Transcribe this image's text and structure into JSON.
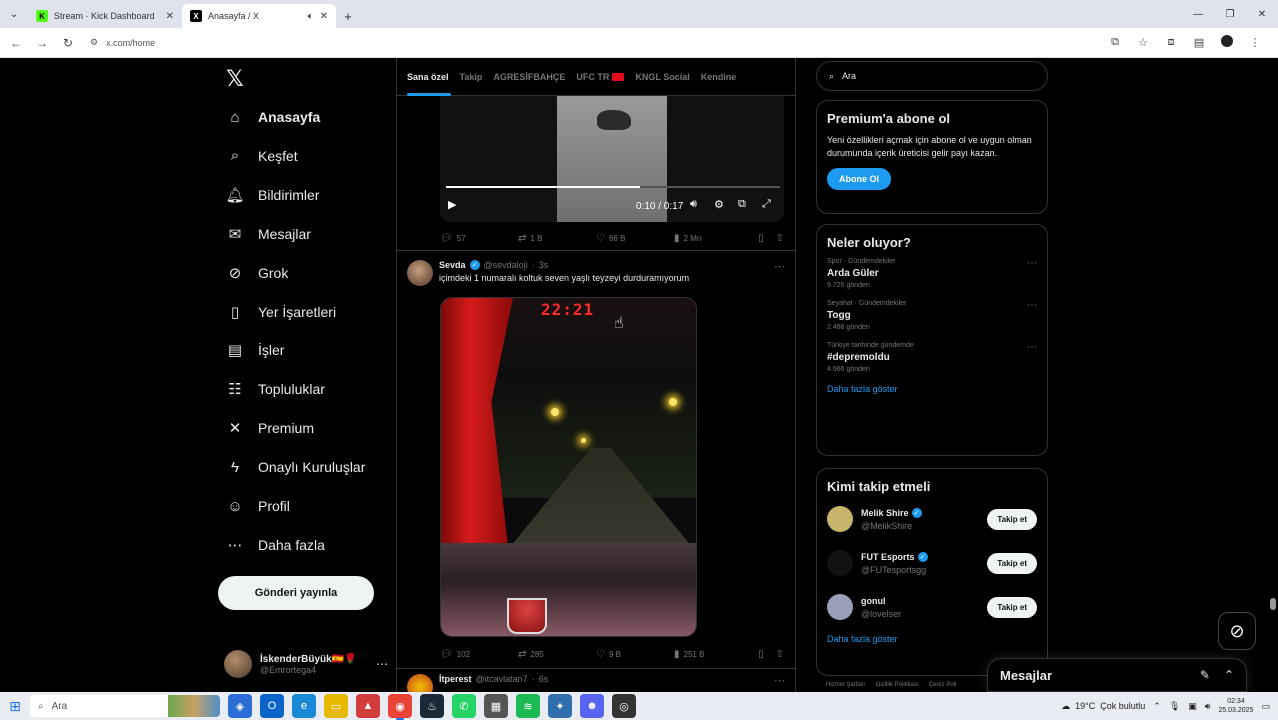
{
  "browser": {
    "tabs": [
      {
        "title": "Stream · Kick Dashboard",
        "favicon": "K",
        "favicon_color": "#53fc18",
        "active": false
      },
      {
        "title": "Anasayfa / X",
        "favicon": "X",
        "favicon_color": "#000000",
        "active": true
      }
    ],
    "url": "x.com/home",
    "new_tab": "+"
  },
  "nav": {
    "items": [
      {
        "label": "Anasayfa",
        "icon": "home-icon",
        "glyph": "⌂",
        "bold": true
      },
      {
        "label": "Keşfet",
        "icon": "search-icon",
        "glyph": "⌕",
        "bold": false
      },
      {
        "label": "Bildirimler",
        "icon": "bell-icon",
        "glyph": "🔔︎",
        "bold": false
      },
      {
        "label": "Mesajlar",
        "icon": "mail-icon",
        "glyph": "✉",
        "bold": false
      },
      {
        "label": "Grok",
        "icon": "grok-icon",
        "glyph": "⊘",
        "bold": false
      },
      {
        "label": "Yer İşaretleri",
        "icon": "bookmark-icon",
        "glyph": "▯",
        "bold": false
      },
      {
        "label": "İşler",
        "icon": "briefcase-icon",
        "glyph": "▤",
        "bold": false
      },
      {
        "label": "Topluluklar",
        "icon": "communities-icon",
        "glyph": "☷",
        "bold": false
      },
      {
        "label": "Premium",
        "icon": "x-logo-icon",
        "glyph": "✕",
        "bold": false
      },
      {
        "label": "Onaylı Kuruluşlar",
        "icon": "lightning-icon",
        "glyph": "ϟ",
        "bold": false
      },
      {
        "label": "Profil",
        "icon": "profile-icon",
        "glyph": "☺",
        "bold": false
      },
      {
        "label": "Daha fazla",
        "icon": "more-circle-icon",
        "glyph": "⋯",
        "bold": false
      }
    ],
    "post_button": "Gönderi yayınla",
    "account": {
      "display_name": "İskenderBüyük🇪🇸🌹",
      "handle": "@Emrortega4"
    }
  },
  "timeline": {
    "tabs": [
      "Sana özel",
      "Takip",
      "AGRESİFBAHÇE",
      "UFC TR",
      "KNGL Social",
      "Kendine"
    ],
    "video1": {
      "time": "0:10 / 0:17",
      "progress": 0.58
    },
    "tweet1_stats": {
      "replies": "57",
      "reposts": "1 B",
      "likes": "66 B",
      "views": "2 Mn"
    },
    "tweet2": {
      "name": "Sevda",
      "handle": "@sevdaloji",
      "age": "3s",
      "text": "içimdeki 1 numaralı koltuk seven yaşlı teyzeyi durduramıyorum",
      "clock": "22:21",
      "stats": {
        "replies": "102",
        "reposts": "285",
        "likes": "9 B",
        "views": "251 B"
      }
    },
    "tweet3": {
      "name": "İtperest",
      "handle": "@itcavlatan7",
      "age": "6s"
    }
  },
  "right": {
    "search_placeholder": "Ara",
    "premium": {
      "title": "Premium'a abone ol",
      "text": "Yeni özellikleri açmak için abone ol ve uygun olman durumunda içerik üreticisi gelir payı kazan.",
      "button": "Abone Ol"
    },
    "trends": {
      "title": "Neler oluyor?",
      "items": [
        {
          "category": "Spor · Gündemdekiler",
          "name": "Arda Güler",
          "count": "9.726 gönderi"
        },
        {
          "category": "Seyahat · Gündemdekiler",
          "name": "Togg",
          "count": "2.486 gönderi"
        },
        {
          "category": "Türkiye tarihinde gündemde",
          "name": "#depremoldu",
          "count": "4.666 gönderi"
        }
      ],
      "show_more": "Daha fazla göster"
    },
    "who_to_follow": {
      "title": "Kimi takip etmeli",
      "items": [
        {
          "name": "Melik Shire",
          "handle": "@MelikShire",
          "button": "Takip et",
          "avatar_color": "#c9b56a"
        },
        {
          "name": "FUT Esports",
          "handle": "@FUTesportsgg",
          "button": "Takip et",
          "avatar_color": "#111111"
        },
        {
          "name": "gonul",
          "handle": "@lovelser",
          "button": "Takip et",
          "avatar_color": "#9aa0b8"
        }
      ],
      "show_more": "Daha fazla göster"
    },
    "footer": [
      "Hizmet Şartları",
      "Gizlilik Politikası",
      "Çerez Poli"
    ]
  },
  "messages_drawer": {
    "title": "Mesajlar"
  },
  "taskbar": {
    "search": "Ara",
    "weather": "19°C",
    "weather_desc": "Çok bulutlu",
    "time": "02:34",
    "date": "25.03.2025"
  }
}
